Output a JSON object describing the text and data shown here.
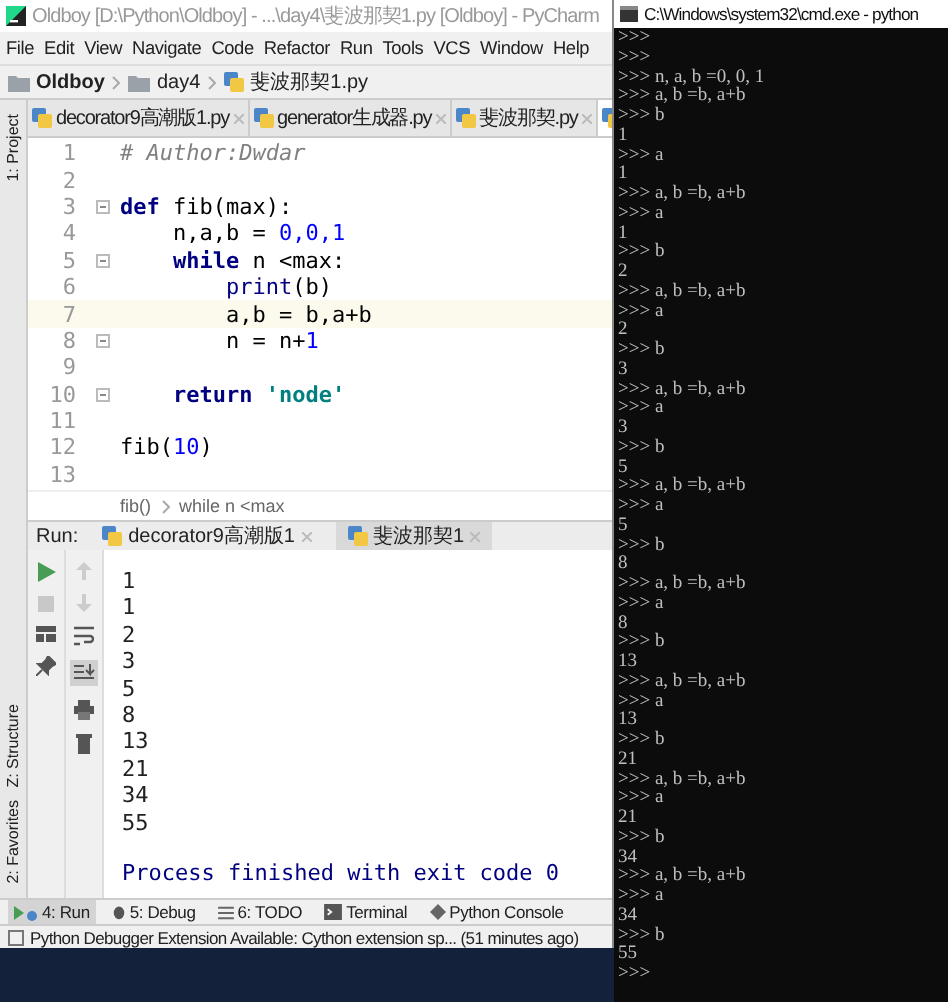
{
  "ide": {
    "title": "Oldboy [D:\\Python\\Oldboy] - ...\\day4\\斐波那契1.py [Oldboy] - PyCharm",
    "menu": [
      "File",
      "Edit",
      "View",
      "Navigate",
      "Code",
      "Refactor",
      "Run",
      "Tools",
      "VCS",
      "Window",
      "Help"
    ],
    "breadcrumbs": [
      {
        "label": "Oldboy",
        "kind": "folder"
      },
      {
        "label": "day4",
        "kind": "folder"
      },
      {
        "label": "斐波那契1.py",
        "kind": "file"
      }
    ],
    "editor_tabs": [
      {
        "label": "decorator9高潮版1.py",
        "selected": false
      },
      {
        "label": "generator生成器.py",
        "selected": false
      },
      {
        "label": "斐波那契.py",
        "selected": false
      },
      {
        "selected": true
      }
    ],
    "side_tabs_top": [
      "1: Project"
    ],
    "side_tabs_bottom": [
      "Z: Structure",
      "2: Favorites"
    ],
    "code": [
      {
        "number": "1",
        "fold": false,
        "current": false,
        "tokens": [
          {
            "kind": "comment",
            "text": "# Author:Dwdar"
          }
        ]
      },
      {
        "number": "2",
        "fold": false,
        "current": false
      },
      {
        "number": "3",
        "fold": true,
        "current": false,
        "tokens": [
          {
            "kind": "keyword",
            "text": "def"
          },
          {
            "kind": "plain",
            "text": " fib(max):"
          }
        ]
      },
      {
        "number": "4",
        "fold": false,
        "current": false,
        "tokens": [
          {
            "kind": "plain",
            "text": "    n,a,b = "
          },
          {
            "kind": "number",
            "text": "0,0,1"
          }
        ]
      },
      {
        "number": "5",
        "fold": true,
        "current": false,
        "tokens": [
          {
            "kind": "keyword",
            "text": "    while"
          },
          {
            "kind": "plain",
            "text": " n <max:"
          }
        ]
      },
      {
        "number": "6",
        "fold": false,
        "current": false,
        "tokens": [
          {
            "kind": "builtin",
            "text": "        print"
          },
          {
            "kind": "plain",
            "text": "(b)"
          }
        ]
      },
      {
        "number": "7",
        "fold": false,
        "current": true,
        "tokens": [
          {
            "kind": "plain",
            "text": "        a,b = b,a+b"
          }
        ]
      },
      {
        "number": "8",
        "fold": true,
        "current": false,
        "tokens": [
          {
            "kind": "plain",
            "text": "        n = n+"
          },
          {
            "kind": "number",
            "text": "1"
          }
        ]
      },
      {
        "number": "9",
        "fold": false,
        "current": false
      },
      {
        "number": "10",
        "fold": true,
        "current": false,
        "tokens": [
          {
            "kind": "keyword",
            "text": "    return "
          },
          {
            "kind": "string",
            "text": "'node'"
          }
        ]
      },
      {
        "number": "11",
        "fold": false,
        "current": false
      },
      {
        "number": "12",
        "fold": false,
        "current": false,
        "tokens": [
          {
            "kind": "plain",
            "text": "fib("
          },
          {
            "kind": "number",
            "text": "10"
          },
          {
            "kind": "plain",
            "text": ")"
          }
        ]
      },
      {
        "number": "13",
        "fold": false,
        "current": false
      }
    ],
    "code_breadcrumb": [
      "fib()",
      "while n <max"
    ],
    "run": {
      "label": "Run:",
      "tabs": [
        {
          "label": "decorator9高潮版1",
          "selected": false
        },
        {
          "label": "斐波那契1",
          "selected": true
        }
      ],
      "output": [
        "1",
        "1",
        "2",
        "3",
        "5",
        "8",
        "13",
        "21",
        "34",
        "55"
      ],
      "exit_message": "Process finished with exit code 0"
    },
    "tool_tabs": [
      {
        "label": "4: Run",
        "kind": "run",
        "selected": true
      },
      {
        "label": "5: Debug",
        "kind": "debug",
        "selected": false
      },
      {
        "label": "6: TODO",
        "kind": "todo",
        "selected": false
      },
      {
        "label": "Terminal",
        "kind": "terminal",
        "selected": false
      },
      {
        "label": "Python Console",
        "kind": "console",
        "selected": false
      }
    ],
    "status": "Python Debugger Extension Available: Cython extension sp... (51 minutes ago)"
  },
  "console": {
    "title": "C:\\Windows\\system32\\cmd.exe - python",
    "lines": [
      ">>>",
      ">>>",
      ">>> n, a, b =0, 0, 1",
      ">>> a, b =b, a+b",
      ">>> b",
      "1",
      ">>> a",
      "1",
      ">>> a, b =b, a+b",
      ">>> a",
      "1",
      ">>> b",
      "2",
      ">>> a, b =b, a+b",
      ">>> a",
      "2",
      ">>> b",
      "3",
      ">>> a, b =b, a+b",
      ">>> a",
      "3",
      ">>> b",
      "5",
      ">>> a, b =b, a+b",
      ">>> a",
      "5",
      ">>> b",
      "8",
      ">>> a, b =b, a+b",
      ">>> a",
      "8",
      ">>> b",
      "13",
      ">>> a, b =b, a+b",
      ">>> a",
      "13",
      ">>> b",
      "21",
      ">>> a, b =b, a+b",
      ">>> a",
      "21",
      ">>> b",
      "34",
      ">>> a, b =b, a+b",
      ">>> a",
      "34",
      ">>> b",
      "55",
      ">>>"
    ]
  }
}
